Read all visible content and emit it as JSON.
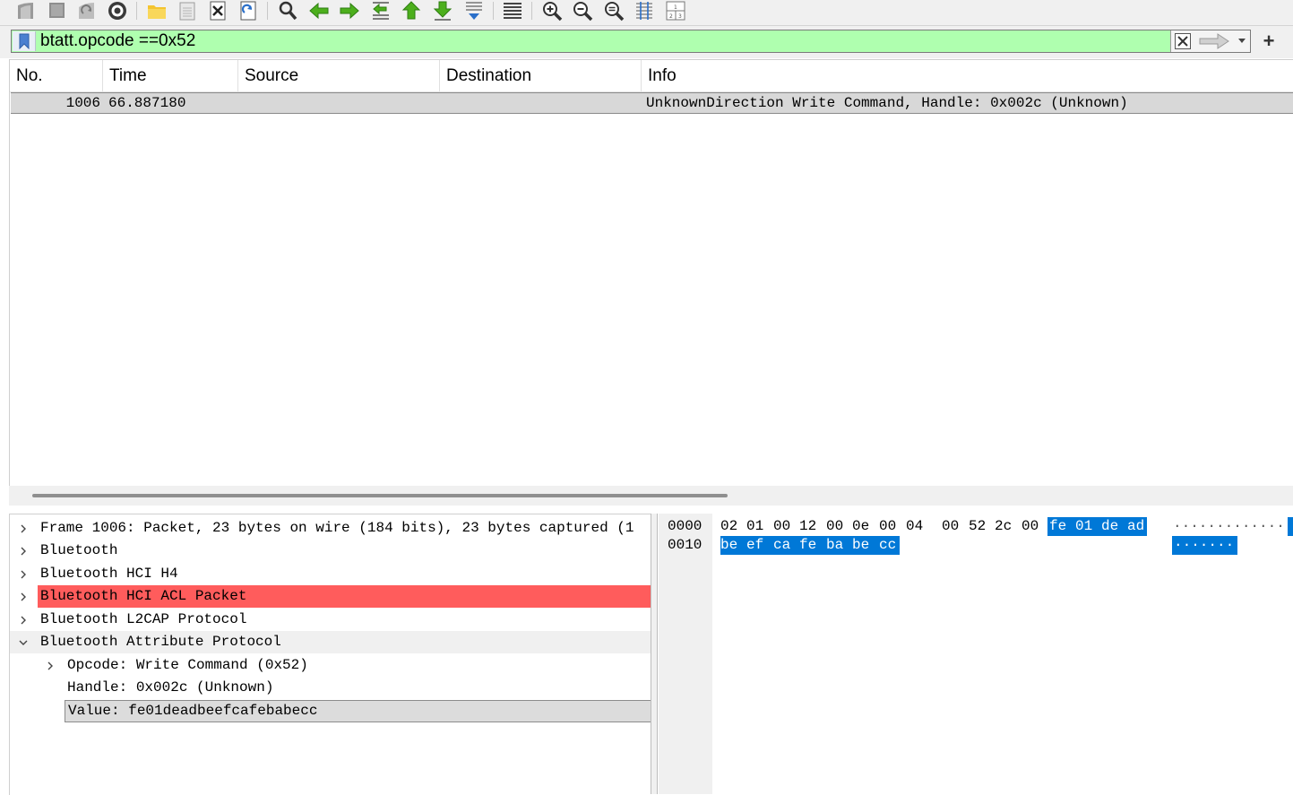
{
  "filter": {
    "value": "btatt.opcode ==0x52",
    "bg": "#afffaf"
  },
  "toolbar": {
    "icons": [
      "start-capture-icon",
      "stop-capture-icon",
      "restart-capture-icon",
      "capture-options-icon",
      "open-file-icon",
      "save-file-icon",
      "close-file-icon",
      "reload-file-icon",
      "find-packet-icon",
      "go-back-icon",
      "go-forward-icon",
      "go-to-packet-icon",
      "first-packet-icon",
      "last-packet-icon",
      "auto-scroll-icon",
      "colorize-icon",
      "zoom-in-icon",
      "zoom-out-icon",
      "normal-size-icon",
      "resize-columns-icon",
      "layout-icon"
    ]
  },
  "packet_list": {
    "columns": [
      "No.",
      "Time",
      "Source",
      "Destination",
      "Info"
    ],
    "rows": [
      {
        "no": "1006",
        "time": "66.887180",
        "source": "",
        "destination": "",
        "info": "UnknownDirection Write Command, Handle: 0x002c (Unknown)"
      }
    ]
  },
  "details": {
    "items": [
      {
        "label": "Frame 1006: Packet, 23 bytes on wire (184 bits), 23 bytes captured (1",
        "state": "collapsed",
        "level": 0
      },
      {
        "label": "Bluetooth",
        "state": "collapsed",
        "level": 0
      },
      {
        "label": "Bluetooth HCI H4",
        "state": "collapsed",
        "level": 0
      },
      {
        "label": "Bluetooth HCI ACL Packet",
        "state": "collapsed",
        "level": 0,
        "highlight": "#ff5c5c"
      },
      {
        "label": "Bluetooth L2CAP Protocol",
        "state": "collapsed",
        "level": 0
      },
      {
        "label": "Bluetooth Attribute Protocol",
        "state": "expanded",
        "level": 0
      },
      {
        "label": "Opcode: Write Command (0x52)",
        "state": "collapsed",
        "level": 1
      },
      {
        "label": "Handle: 0x002c (Unknown)",
        "state": "leaf",
        "level": 1
      },
      {
        "label": "Value: fe01deadbeefcafebabecc",
        "state": "leaf",
        "level": 1,
        "selected": true
      }
    ]
  },
  "bytes": {
    "lines": [
      {
        "offset": "0000",
        "hex": [
          "02",
          "01",
          "00",
          "12",
          "00",
          "0e",
          "00",
          "04",
          "00",
          "52",
          "2c",
          "00",
          "fe",
          "01",
          "de",
          "ad"
        ],
        "ascii": "··············R,··"
      },
      {
        "offset": "0010",
        "hex": [
          "be",
          "ef",
          "ca",
          "fe",
          "ba",
          "be",
          "cc"
        ],
        "ascii": "·······"
      }
    ],
    "selection_color": "#0078d7"
  }
}
